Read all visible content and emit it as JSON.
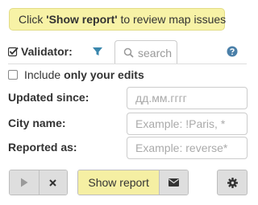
{
  "banner": {
    "prefix": "Click ",
    "emphasis": "'Show report'",
    "suffix": " to review map issues"
  },
  "header": {
    "title": "Validator:",
    "checked": true,
    "filter_icon": "filter-icon",
    "search_tab_label": "search",
    "search_icon": "search-icon",
    "help_icon": "question-circle-icon"
  },
  "include_edits": {
    "checked": false,
    "label_prefix": "Include",
    "label_bold": "only your edits"
  },
  "form": {
    "updated_since": {
      "label": "Updated since:",
      "placeholder": "дд.мм.гггг",
      "value": ""
    },
    "city_name": {
      "label": "City name:",
      "placeholder": "Example: !Paris, *",
      "value": ""
    },
    "reported_as": {
      "label": "Reported as:",
      "placeholder": "Example: reverse*",
      "value": ""
    }
  },
  "toolbar": {
    "play_icon": "play-icon",
    "clear_icon": "close-icon",
    "show_report_label": "Show report",
    "mail_icon": "envelope-icon",
    "settings_icon": "gear-icon"
  },
  "colors": {
    "highlight": "#f7f2a6",
    "button_gray": "#dedede",
    "filter_blue": "#3a87ad",
    "help_blue": "#4a7fa8"
  }
}
